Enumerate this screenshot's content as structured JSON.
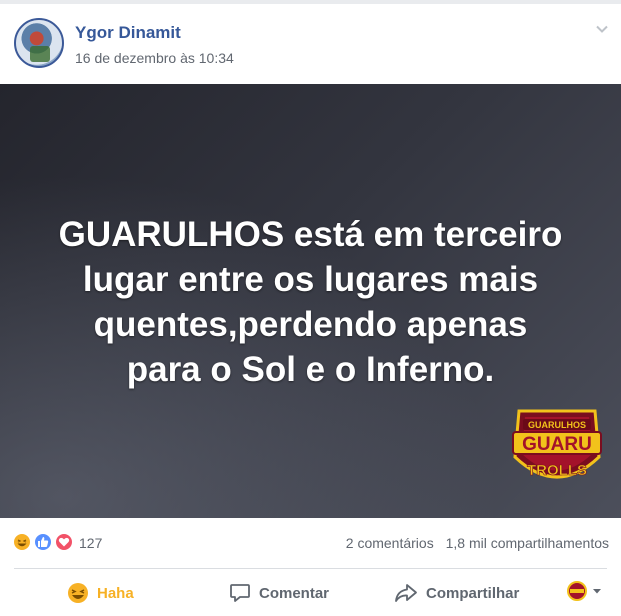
{
  "post": {
    "author": "Ygor Dinamit",
    "timestamp": "16 de dezembro às 10:34",
    "image_text": "GUARULHOS está em terceiro lugar entre os lugares mais quentes,perdendo apenas para o Sol e o Inferno.",
    "image_text_lines": [
      "GUARULHOS está em terceiro",
      "lugar entre os lugares mais",
      "quentes,perdendo apenas",
      "para o Sol e o Inferno."
    ],
    "logo_text": {
      "top": "GUARULHOS",
      "middle": "GUARU",
      "bottom": "TROLLS"
    }
  },
  "stats": {
    "reaction_icons": [
      "haha-icon",
      "like-icon",
      "love-icon"
    ],
    "reaction_count": "127",
    "comments": "2 comentários",
    "shares": "1,8 mil compartilhamentos"
  },
  "actions": {
    "haha_label": "Haha",
    "comment_label": "Comentar",
    "share_label": "Compartilhar"
  },
  "colors": {
    "author": "#365899",
    "haha": "#f7b125",
    "like": "#5890ff",
    "love": "#f25268",
    "logo_red": "#a3122a",
    "logo_gold": "#f2c21b"
  }
}
